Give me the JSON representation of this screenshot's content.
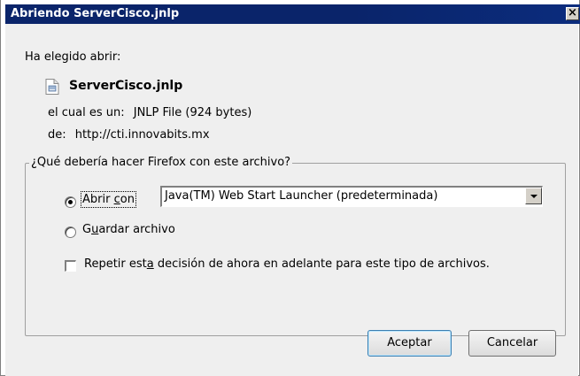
{
  "window": {
    "title": "Abriendo ServerCisco.jnlp",
    "close_glyph": "×"
  },
  "dialog": {
    "chosen_label": "Ha elegido abrir:",
    "file_name": "ServerCisco.jnlp",
    "file_icon": "jnlp-file-icon",
    "type_key": "el cual es un:",
    "type_value": "JNLP File (924 bytes)",
    "from_key": "de:",
    "from_value": "http://cti.innovabits.mx"
  },
  "group": {
    "legend": "¿Qué debería hacer Firefox con este archivo?",
    "open_with_label_pre": "Abrir ",
    "open_with_label_access": "c",
    "open_with_label_post": "on",
    "open_with_checked": true,
    "open_with_app": "Java(TM) Web Start Launcher (predeterminada)",
    "save_label_pre": "G",
    "save_label_access": "u",
    "save_label_post": "ardar archivo",
    "save_checked": false,
    "remember_label_pre": "Repetir est",
    "remember_label_access": "a",
    "remember_label_post": " decisión de ahora en adelante para este tipo de archivos.",
    "remember_checked": false
  },
  "buttons": {
    "ok": "Aceptar",
    "cancel": "Cancelar"
  },
  "colors": {
    "titlebar": "#0a246a",
    "dialog_bg": "#efefef"
  }
}
